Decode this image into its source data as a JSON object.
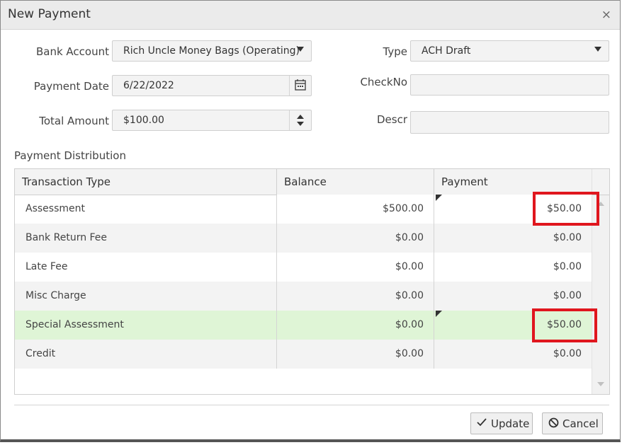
{
  "dialog": {
    "title": "New Payment",
    "close_glyph": "×"
  },
  "form": {
    "bank_account": {
      "label": "Bank Account",
      "value": "Rich Uncle Money Bags (Operating)"
    },
    "payment_date": {
      "label": "Payment Date",
      "value": "6/22/2022"
    },
    "total_amount": {
      "label": "Total Amount",
      "value": "$100.00"
    },
    "type": {
      "label": "Type",
      "value": "ACH Draft"
    },
    "check_no": {
      "label": "CheckNo",
      "value": ""
    },
    "descr": {
      "label": "Descr",
      "value": ""
    }
  },
  "distribution": {
    "section_label": "Payment Distribution",
    "headers": [
      "Transaction Type",
      "Balance",
      "Payment"
    ],
    "rows": [
      {
        "type": "Assessment",
        "balance": "$500.00",
        "payment": "$50.00"
      },
      {
        "type": "Bank Return Fee",
        "balance": "$0.00",
        "payment": "$0.00"
      },
      {
        "type": "Late Fee",
        "balance": "$0.00",
        "payment": "$0.00"
      },
      {
        "type": "Misc Charge",
        "balance": "$0.00",
        "payment": "$0.00"
      },
      {
        "type": "Special Assessment",
        "balance": "$0.00",
        "payment": "$50.00"
      },
      {
        "type": "Credit",
        "balance": "$0.00",
        "payment": "$0.00"
      }
    ]
  },
  "buttons": {
    "update": "Update",
    "cancel": "Cancel"
  },
  "colors": {
    "highlight_row": "#dff5d6",
    "annotation_box": "#e0161e"
  },
  "icons": {
    "calendar": "calendar-icon",
    "update": "check-icon",
    "cancel": "ban-icon"
  }
}
